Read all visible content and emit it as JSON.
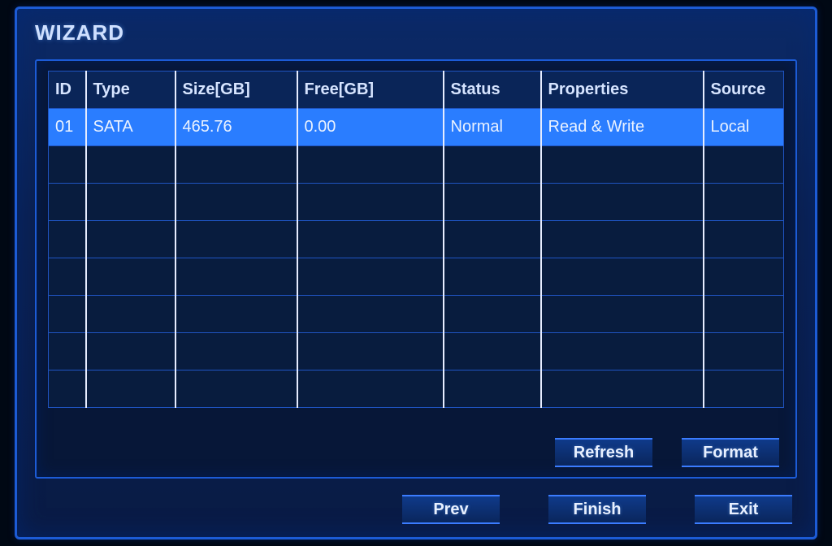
{
  "window": {
    "title": "WIZARD"
  },
  "table": {
    "headers": {
      "id": "ID",
      "type": "Type",
      "size": "Size[GB]",
      "free": "Free[GB]",
      "status": "Status",
      "properties": "Properties",
      "source": "Source"
    },
    "rows": [
      {
        "id": "01",
        "type": "SATA",
        "size": "465.76",
        "free": "0.00",
        "status": "Normal",
        "properties": "Read & Write",
        "source": "Local"
      }
    ],
    "empty_row_count": 7
  },
  "buttons": {
    "refresh": "Refresh",
    "format": "Format",
    "prev": "Prev",
    "finish": "Finish",
    "exit": "Exit"
  }
}
